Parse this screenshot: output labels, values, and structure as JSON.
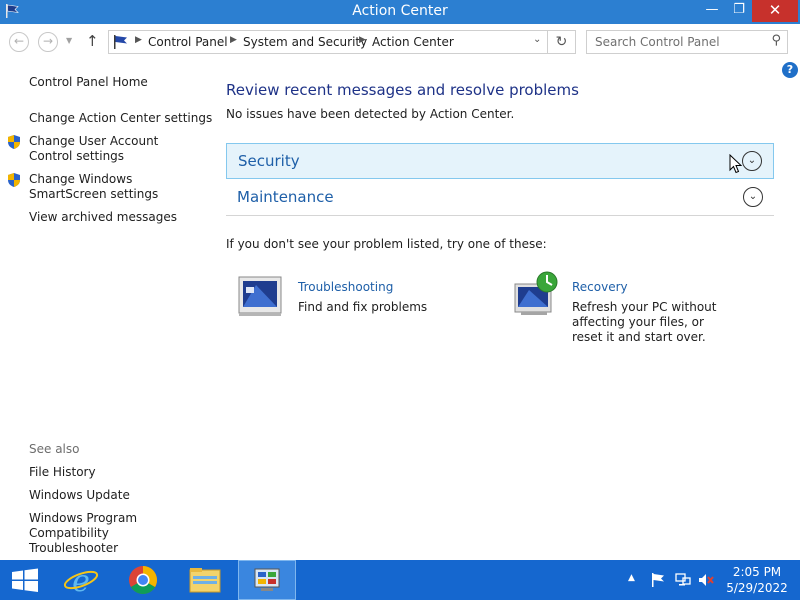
{
  "window": {
    "title": "Action Center",
    "minimize_glyph": "—",
    "maximize_glyph": "❐",
    "close_glyph": "✕"
  },
  "nav": {
    "back_glyph": "←",
    "forward_glyph": "→",
    "recent_glyph": "▼",
    "up_glyph": "↑"
  },
  "address": {
    "crumbs": [
      "Control Panel",
      "System and Security",
      "Action Center"
    ],
    "separator": "▶",
    "dropdown_glyph": "⌄",
    "refresh_glyph": "↻"
  },
  "search": {
    "placeholder": "Search Control Panel",
    "icon_glyph": "⚲"
  },
  "sidebar": {
    "home": "Control Panel Home",
    "links": [
      "Change Action Center settings",
      "Change User Account Control settings",
      "Change Windows SmartScreen settings",
      "View archived messages"
    ],
    "see_also_heading": "See also",
    "see_also": [
      "File History",
      "Windows Update",
      "Windows Program Compatibility Troubleshooter"
    ]
  },
  "main": {
    "title": "Review recent messages and resolve problems",
    "subtitle": "No issues have been detected by Action Center.",
    "sections": [
      {
        "label": "Security"
      },
      {
        "label": "Maintenance"
      }
    ],
    "expand_glyph": "⌄",
    "try_text": "If you don't see your problem listed, try one of these:",
    "tiles": [
      {
        "link": "Troubleshooting",
        "description": "Find and fix problems"
      },
      {
        "link": "Recovery",
        "description": "Refresh your PC without affecting your files, or reset it and start over."
      }
    ]
  },
  "help_glyph": "?",
  "taskbar": {
    "apps": [
      "start-icon",
      "internet-explorer-icon",
      "chrome-icon",
      "file-explorer-icon",
      "control-panel-icon"
    ],
    "tray_up_glyph": "▲",
    "time": "2:05 PM",
    "date": "5/29/2022"
  },
  "colors": {
    "titlebar": "#2c7fd1",
    "taskbar": "#1567cf",
    "link": "#1e5fa8",
    "heading": "#1e3287",
    "section_highlight": "#e5f3fb"
  }
}
